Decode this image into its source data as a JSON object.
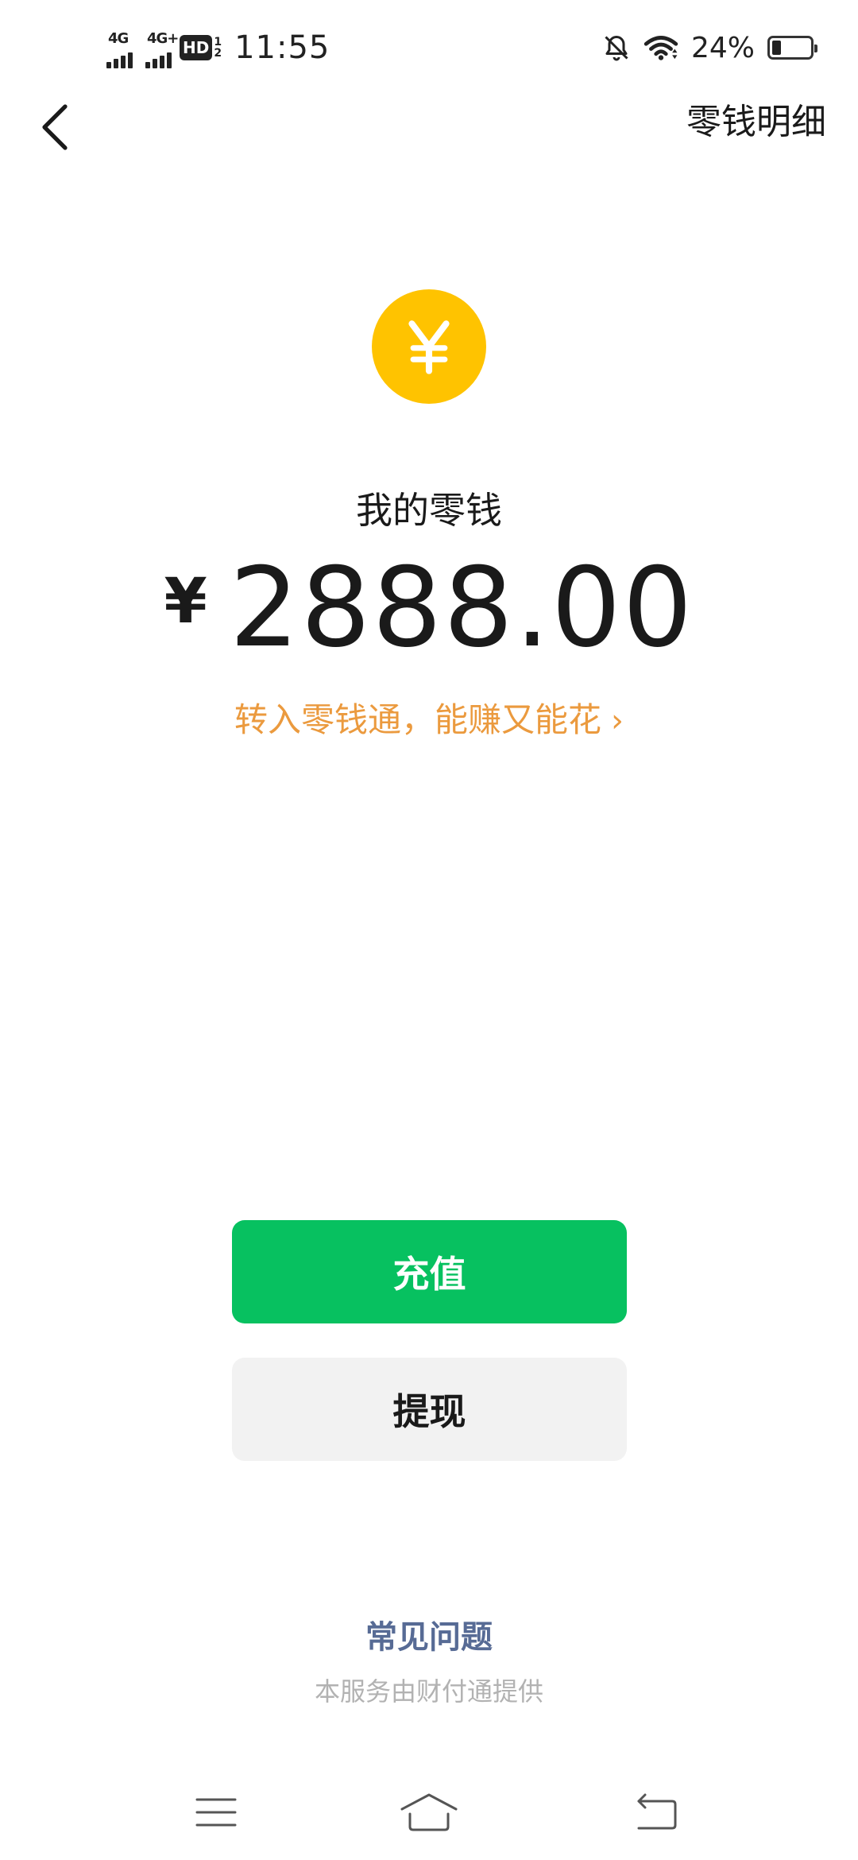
{
  "status_bar": {
    "sim1_network": "4G",
    "sim2_network": "4G+",
    "hd_label": "HD",
    "hd_slot_top": "1",
    "hd_slot_bottom": "2",
    "time": "11:55",
    "battery_percent": "24%",
    "battery_level": 0.24,
    "icons": [
      "alarm-off-icon",
      "wifi-icon",
      "battery-icon"
    ]
  },
  "header": {
    "back_icon": "chevron-left-icon",
    "details_link": "零钱明细"
  },
  "wallet": {
    "coin_icon": "yuan-coin-icon",
    "coin_color": "#ffc300",
    "balance_label": "我的零钱",
    "currency_symbol": "¥",
    "amount": "2888.00",
    "promo_text": "转入零钱通，能赚又能花",
    "promo_chevron": "›",
    "promo_color": "#eb9a3e"
  },
  "actions": {
    "recharge_label": "充值",
    "recharge_color": "#07c160",
    "withdraw_label": "提现"
  },
  "footer": {
    "faq_link": "常见问题",
    "provider_text": "本服务由财付通提供"
  },
  "nav_bar": {
    "icons": [
      "menu-icon",
      "home-icon",
      "back-nav-icon"
    ]
  }
}
